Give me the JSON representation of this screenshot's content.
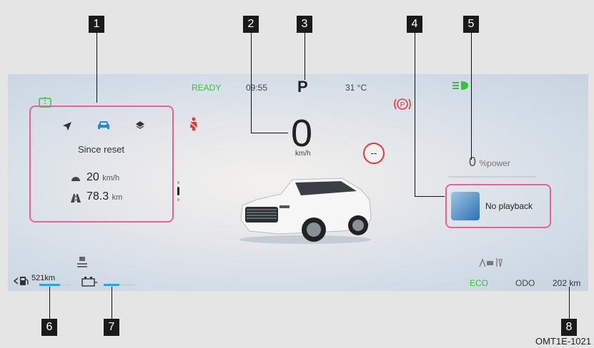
{
  "callouts": [
    "1",
    "2",
    "3",
    "4",
    "5",
    "6",
    "7",
    "8"
  ],
  "figure_code": "OMT1E-1021",
  "status": {
    "ready": "READY",
    "time": "09:55",
    "gear": "P",
    "temperature": "31 °C"
  },
  "speed": {
    "value": "0",
    "unit": "km/h",
    "limit": "--"
  },
  "trip": {
    "heading": "Since reset",
    "avg_speed_value": "20",
    "avg_speed_unit": "km/h",
    "distance_value": "78.3",
    "distance_unit": "km"
  },
  "power": {
    "value": "0",
    "unit": "%power",
    "level": 0
  },
  "media": {
    "status": "No playback"
  },
  "range": {
    "value": "521km",
    "fuel_level": 0.65
  },
  "battery": {
    "level": 0.5
  },
  "footer": {
    "mode": "ECO",
    "odo_label": "ODO",
    "odo_value": "202 km"
  },
  "colors": {
    "accent_green": "#3bbf3e",
    "callout_border": "#e8619a",
    "bar_blue": "#2aa3e0",
    "warning_red": "#e23a3a"
  }
}
